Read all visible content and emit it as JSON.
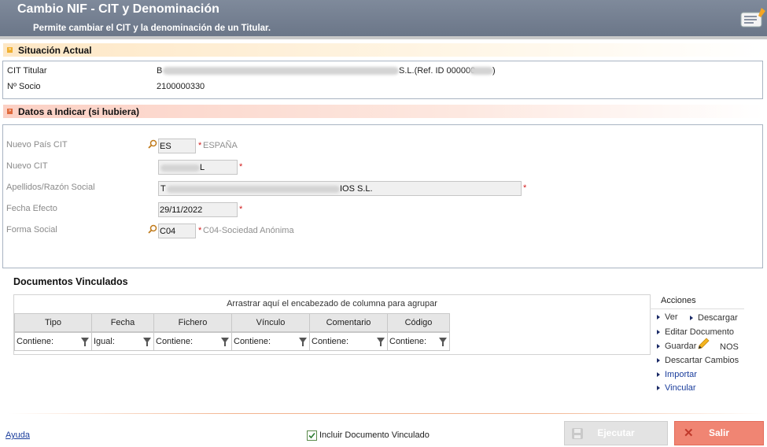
{
  "header": {
    "title": "Cambio NIF - CIT y Denominación",
    "subtitle": "Permite cambiar el CIT y la denominación de un Titular."
  },
  "situacion": {
    "section_title": "Situación Actual",
    "cit_label": "CIT Titular",
    "cit_value_prefix": "B",
    "cit_value_suffix": "S.L.(Ref. ID 000000",
    "cit_value_end": ")",
    "socio_label": "Nº Socio",
    "socio_value": "2100000330"
  },
  "datos": {
    "section_title": "Datos a Indicar (si hubiera)",
    "pais_label": "Nuevo País CIT",
    "pais_value": "ES",
    "pais_desc": "ESPAÑA",
    "cit_label": "Nuevo CIT",
    "cit_value_suffix": "L",
    "razon_label": "Apellidos/Razón Social",
    "razon_prefix": "T",
    "razon_suffix": "IOS S.L.",
    "fecha_label": "Fecha Efecto",
    "fecha_value": "29/11/2022",
    "forma_label": "Forma Social",
    "forma_value": "C04",
    "forma_desc": "C04-Sociedad Anónima",
    "required_mark": "*"
  },
  "documentos": {
    "title": "Documentos Vinculados",
    "group_hint": "Arrastrar aquí el encabezado de columna para agrupar",
    "columns": [
      "Tipo",
      "Fecha",
      "Fichero",
      "Vínculo",
      "Comentario",
      "Código"
    ],
    "filters": [
      "Contiene:",
      "Igual:",
      "Contiene:",
      "Contiene:",
      "Contiene:",
      "Contiene:"
    ]
  },
  "acciones": {
    "title": "Acciones",
    "ver": "Ver",
    "descargar": "Descargar",
    "editar": "Editar Documento",
    "guardar": "Guardar",
    "nos": "NOS",
    "descartar": "Descartar Cambios",
    "importar": "Importar",
    "vincular": "Vincular"
  },
  "footer": {
    "ayuda": "Ayuda",
    "incluir": "Incluir Documento Vinculado",
    "incluir_checked": true,
    "ejecutar": "Ejecutar",
    "salir": "Salir"
  },
  "colors": {
    "header": "#737e90",
    "accent_orange": "#f0b030",
    "accent_red": "#e06a3c",
    "salir": "#f08573"
  }
}
